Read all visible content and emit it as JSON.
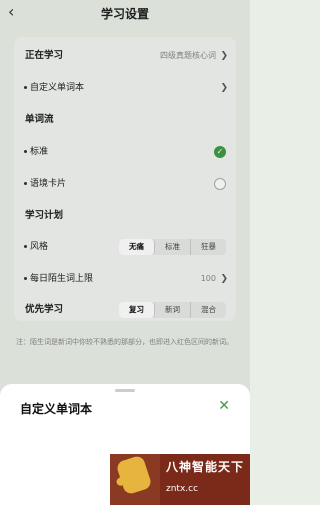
{
  "header": {
    "title": "学习设置",
    "back_glyph": "‹"
  },
  "settings": {
    "current_label": "正在学习",
    "current_value": "四级真题核心词",
    "custom_book": "自定义单词本",
    "stream_label": "单词流",
    "stream_opt1": "标准",
    "stream_opt2": "语境卡片",
    "plan_label": "学习计划",
    "style_label": "风格",
    "style_options": [
      "无痛",
      "标准",
      "狂暴"
    ],
    "limit_label": "每日陌生词上限",
    "limit_value": "100",
    "priority_label": "优先学习",
    "priority_options": [
      "复习",
      "新词",
      "混合"
    ]
  },
  "note": "注：陌生词是新词中你较不熟悉的那部分，也即进入红色区间的新词。",
  "sheet": {
    "title": "自定义单词本",
    "close_glyph": "✕"
  },
  "watermark": {
    "text1": "八神智能天下",
    "text2": "zntx.cc"
  },
  "colors": {
    "accent": "#3f9b44",
    "background": "#e9efe7",
    "card": "#f1f4f0"
  }
}
